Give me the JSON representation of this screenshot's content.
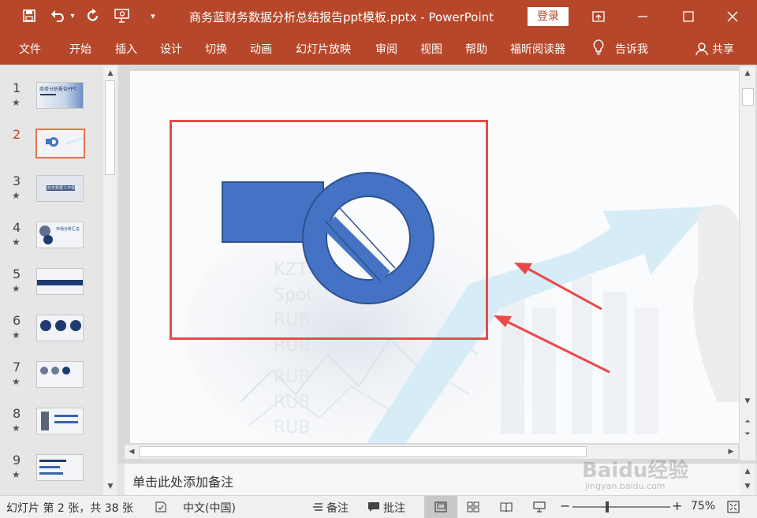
{
  "titlebar": {
    "title": "商务蓝财务数据分析总结报告ppt模板.pptx  -  PowerPoint",
    "login": "登录",
    "icons": [
      "save-icon",
      "undo-icon",
      "redo-icon",
      "present-icon",
      "customize-icon"
    ],
    "window_buttons": [
      "ribbon-display-icon",
      "minimize-icon",
      "maximize-icon",
      "close-icon"
    ]
  },
  "ribbon": {
    "tabs": [
      "文件",
      "开始",
      "插入",
      "设计",
      "切换",
      "动画",
      "幻灯片放映",
      "审阅",
      "视图",
      "帮助",
      "福昕阅读器",
      "告诉我"
    ],
    "share": "共享"
  },
  "thumbnails": [
    {
      "num": "1",
      "star": "★",
      "caption": "商务分析报告PPT"
    },
    {
      "num": "2",
      "star": "",
      "caption": ""
    },
    {
      "num": "3",
      "star": "★",
      "caption": "财务数据工作报告"
    },
    {
      "num": "4",
      "star": "★",
      "caption": "市场分析汇总"
    },
    {
      "num": "5",
      "star": "★",
      "caption": ""
    },
    {
      "num": "6",
      "star": "★",
      "caption": ""
    },
    {
      "num": "7",
      "star": "★",
      "caption": ""
    },
    {
      "num": "8",
      "star": "★",
      "caption": ""
    },
    {
      "num": "9",
      "star": "★",
      "caption": ""
    }
  ],
  "slide": {
    "background_text": [
      "KZT",
      "Spot",
      "RUB",
      "RUB",
      "RUB",
      "RUB",
      "RUB"
    ]
  },
  "notes": {
    "placeholder": "单击此处添加备注"
  },
  "status": {
    "slide_info": "幻灯片 第 2 张，共 38 张",
    "language": "中文(中国)",
    "notes_btn": "备注",
    "comments_btn": "批注",
    "zoom": "75%"
  },
  "watermark": {
    "text": "Baidu经验",
    "url": "jingyan.baidu.com"
  },
  "colors": {
    "accent": "#b7472a",
    "shape_fill": "#4472c4",
    "shape_stroke": "#2f528f",
    "highlight": "#e84a4a"
  }
}
